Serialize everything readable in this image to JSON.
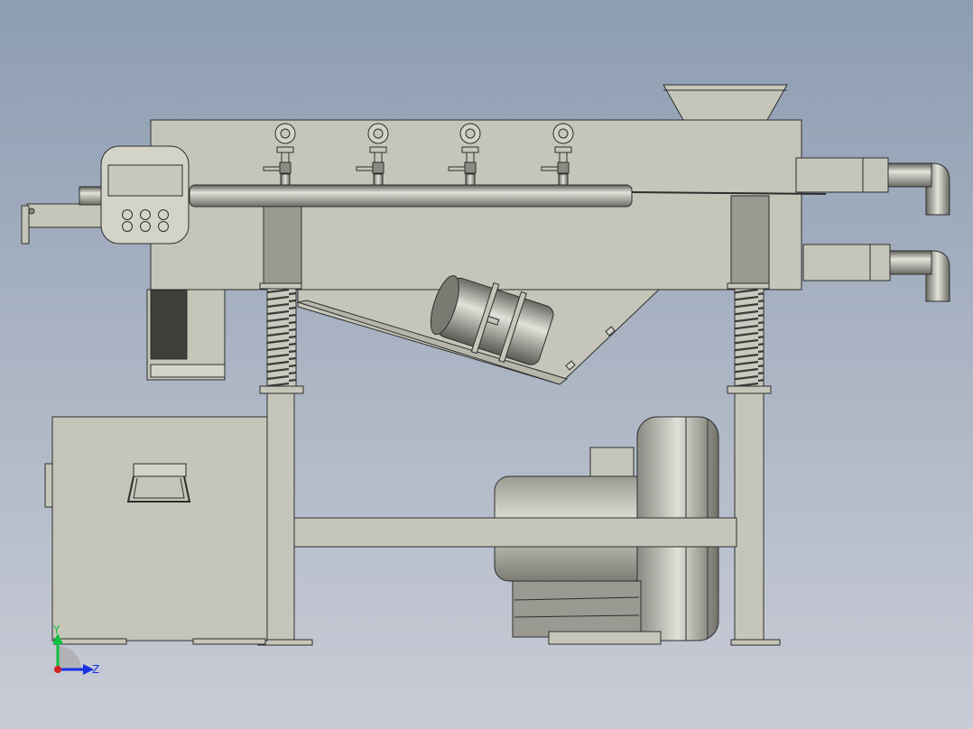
{
  "colors": {
    "bg_top": "#8d9db2",
    "bg_bottom": "#c9ccd6",
    "body": "#c5c5b9",
    "body_light": "#d3d3c8",
    "edge": "#2e2e2e",
    "dark_panel": "#3d3f3b",
    "spring": "#8a8a82",
    "axis_x": "#d02020",
    "axis_y": "#10c040",
    "axis_z": "#1830e0"
  },
  "triad": {
    "y_label": "Y",
    "z_label": "Z"
  },
  "controller": {
    "button_count": 6
  },
  "valves": {
    "count": 4
  }
}
